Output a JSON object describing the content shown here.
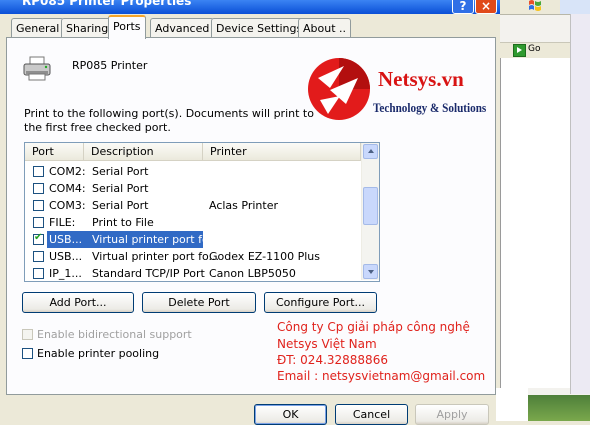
{
  "window": {
    "title": "RP085 Printer Properties",
    "help_glyph": "?",
    "close_glyph": "×"
  },
  "tabs": [
    "General",
    "Sharing",
    "Ports",
    "Advanced",
    "Device Settings",
    "About .."
  ],
  "active_tab": "Ports",
  "printer": {
    "name": "RP085 Printer",
    "icon": "printer-icon"
  },
  "logo": {
    "title": "Netsys.vn",
    "subtitle": "Technology & Solutions"
  },
  "instruction": "Print to the following port(s). Documents will print to the first free checked port.",
  "port_table": {
    "columns": [
      "Port",
      "Description",
      "Printer"
    ],
    "rows": [
      {
        "port": "COM2:",
        "description": "Serial Port",
        "printer": "",
        "checked": false,
        "selected": false
      },
      {
        "port": "COM4:",
        "description": "Serial Port",
        "printer": "",
        "checked": false,
        "selected": false
      },
      {
        "port": "COM3:",
        "description": "Serial Port",
        "printer": "Aclas Printer",
        "checked": false,
        "selected": false
      },
      {
        "port": "FILE:",
        "description": "Print to File",
        "printer": "",
        "checked": false,
        "selected": false
      },
      {
        "port": "USB...",
        "description": "Virtual printer port fo...",
        "printer": "",
        "checked": true,
        "selected": true
      },
      {
        "port": "USB...",
        "description": "Virtual printer port fo...",
        "printer": "Godex EZ-1100 Plus",
        "checked": false,
        "selected": false
      },
      {
        "port": "IP_1...",
        "description": "Standard TCP/IP Port",
        "printer": "Canon LBP5050",
        "checked": false,
        "selected": false
      }
    ]
  },
  "port_buttons": {
    "add": "Add Port...",
    "delete": "Delete Port",
    "configure": "Configure Port..."
  },
  "options": {
    "bidirectional": {
      "label": "Enable bidirectional support",
      "checked": false,
      "enabled": false
    },
    "pooling": {
      "label": "Enable printer pooling",
      "checked": false,
      "enabled": true
    }
  },
  "company": {
    "line1": "Công ty Cp giải pháp công nghệ",
    "line2": "Netsys Việt Nam",
    "phone": "ĐT: 024.32888866",
    "email": "Email : netsysvietnam@gmail.com"
  },
  "dialog_buttons": {
    "ok": "OK",
    "cancel": "Cancel",
    "apply": "Apply"
  },
  "background_window": {
    "go_label": "Go"
  },
  "colors": {
    "company_text": "#e0221c",
    "logo_red": "#d81313",
    "logo_navy": "#1a2a6b",
    "selection": "#316ac5",
    "xp_accent": "#f6a52a"
  }
}
